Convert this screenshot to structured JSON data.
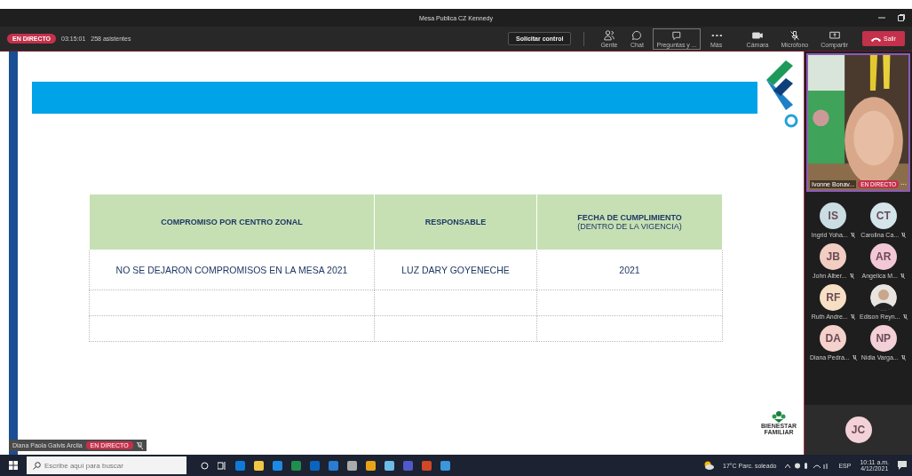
{
  "window": {
    "title": "Mesa Publica CZ Kennedy"
  },
  "meeting_bar": {
    "live_badge": "EN DIRECTO",
    "elapsed": "03:15:01",
    "attendees": "258 asistentes",
    "request_control": "Solicitar control",
    "actions": [
      {
        "kind": "people",
        "label": "Gente",
        "selected": false
      },
      {
        "kind": "chat",
        "label": "Chat",
        "selected": false
      },
      {
        "kind": "questions",
        "label": "Preguntas y ...",
        "selected": true
      },
      {
        "kind": "more",
        "label": "Más",
        "selected": false
      }
    ],
    "devices": [
      {
        "kind": "camera",
        "label": "Cámara"
      },
      {
        "kind": "mic",
        "label": "Micrófono"
      },
      {
        "kind": "share",
        "label": "Compartir"
      }
    ],
    "leave": "Salir"
  },
  "slide": {
    "table": {
      "columns": [
        {
          "label": "COMPROMISO POR CENTRO ZONAL"
        },
        {
          "label": "RESPONSABLE"
        },
        {
          "label": "FECHA DE CUMPLIMIENTO",
          "note": "(DENTRO DE LA VIGENCIA)"
        }
      ],
      "rows": [
        [
          "NO SE DEJARON COMPROMISOS EN LA MESA 2021",
          "LUZ DARY GOYENECHE",
          "2021"
        ],
        [
          "",
          "",
          ""
        ],
        [
          "",
          "",
          ""
        ]
      ]
    },
    "logo_text": [
      "BIENESTAR",
      "FAMILIAR"
    ]
  },
  "presenter_tag": {
    "name": "Diana Paola Galvis Arcila",
    "badge": "EN DIRECTO"
  },
  "video": {
    "name": "Ivonne Bonav...",
    "badge": "EN DIRECTO",
    "more": "···"
  },
  "participants": [
    {
      "initials": "IS",
      "name": "Ingrid Yoha...",
      "color": "#c9dde3",
      "kind": "initials"
    },
    {
      "initials": "CT",
      "name": "Carolina Ca...",
      "color": "#d3e4ea",
      "kind": "initials"
    },
    {
      "initials": "JB",
      "name": "John Alber...",
      "color": "#f1cdc2",
      "kind": "initials"
    },
    {
      "initials": "AR",
      "name": "Angelica M...",
      "color": "#f3c8d6",
      "kind": "initials"
    },
    {
      "initials": "RF",
      "name": "Ruth Andre...",
      "color": "#f6dfc4",
      "kind": "initials"
    },
    {
      "name": "Edison Reyn..."
    },
    {
      "initials": "DA",
      "name": "Diana Pedra...",
      "color": "#f4d1cb",
      "kind": "initials"
    },
    {
      "initials": "NP",
      "name": "Nidia Varga...",
      "color": "#f3cfd8",
      "kind": "initials"
    }
  ],
  "overflow_participant": {
    "initials": "JC",
    "color": "#f2d2d8"
  },
  "taskbar": {
    "search_placeholder": "Escribe aquí para buscar",
    "weather": "17°C Parc. soleado",
    "language": "ESP",
    "time": "10:11 a.m.",
    "date": "4/12/2021"
  }
}
